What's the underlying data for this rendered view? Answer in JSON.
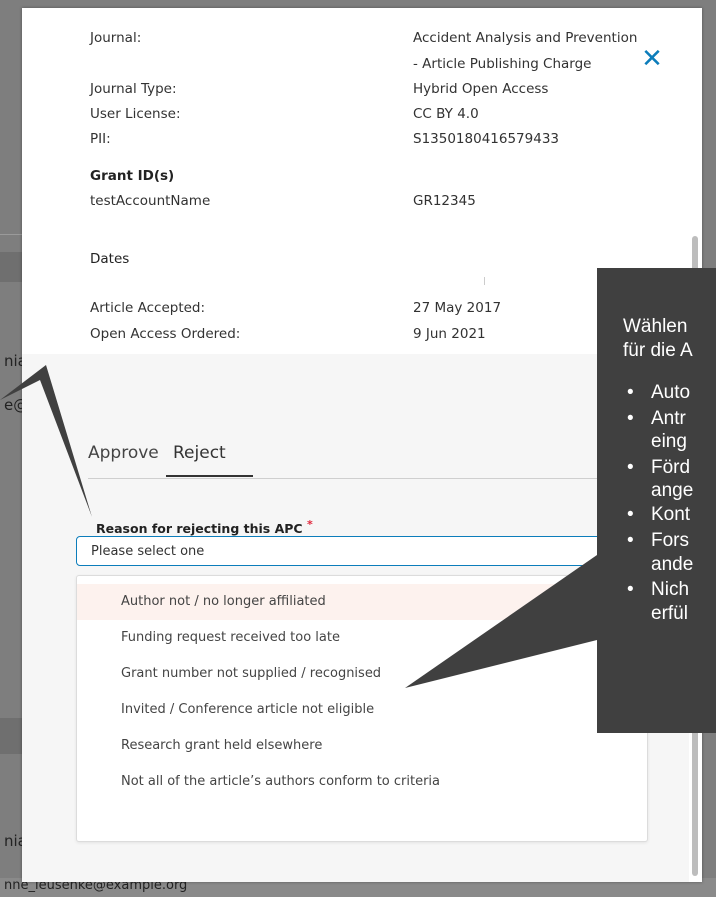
{
  "background": {
    "left_snippets": [
      "nia",
      "e@",
      "nia",
      "nne_leusenke@example.org"
    ]
  },
  "modal": {
    "close_icon": "close-icon",
    "journal": {
      "journal_label": "Journal:",
      "journal_value_line1": "Accident Analysis and Prevention",
      "journal_value_line2": "- Article Publishing Charge",
      "journal_type_label": "Journal Type:",
      "journal_type_value": "Hybrid Open Access",
      "license_label": "User License:",
      "license_value": "CC BY 4.0",
      "pii_label": "PII:",
      "pii_value": "S1350180416579433"
    },
    "grants": {
      "heading": "Grant ID(s)",
      "account_label": "testAccountName",
      "account_value": "GR12345"
    },
    "dates": {
      "heading": "Dates",
      "accepted_label": "Article Accepted:",
      "accepted_value": "27 May 2017",
      "oa_label": "Open Access Ordered:",
      "oa_value": "9 Jun 2021"
    },
    "tabs": [
      {
        "label": "Approve",
        "active": false
      },
      {
        "label": "Reject",
        "active": true
      }
    ],
    "reject_form": {
      "label": "Reason for rejecting this APC",
      "required_marker": "*",
      "placeholder": "Please select one",
      "options": [
        "Author not / no longer affiliated",
        "Funding request received too late",
        "Grant number not supplied / recognised",
        "Invited / Conference article not eligible",
        "Research grant held elsewhere",
        "Not all of the article’s authors conform to criteria"
      ],
      "hovered_index": 0
    }
  },
  "callout": {
    "line1": "Wählen",
    "line2": "für die A",
    "bullet_char": "•",
    "items": [
      {
        "l1": "Auto",
        "l2": ""
      },
      {
        "l1": "Antr",
        "l2": "eing"
      },
      {
        "l1": "Förd",
        "l2": "ange"
      },
      {
        "l1": "Kont",
        "l2": ""
      },
      {
        "l1": "Fors",
        "l2": "ande"
      },
      {
        "l1": "Nich",
        "l2": "erfül"
      }
    ]
  },
  "colors": {
    "accent": "#0c7dbb",
    "callout_bg": "#404040",
    "required": "#e0263b"
  }
}
